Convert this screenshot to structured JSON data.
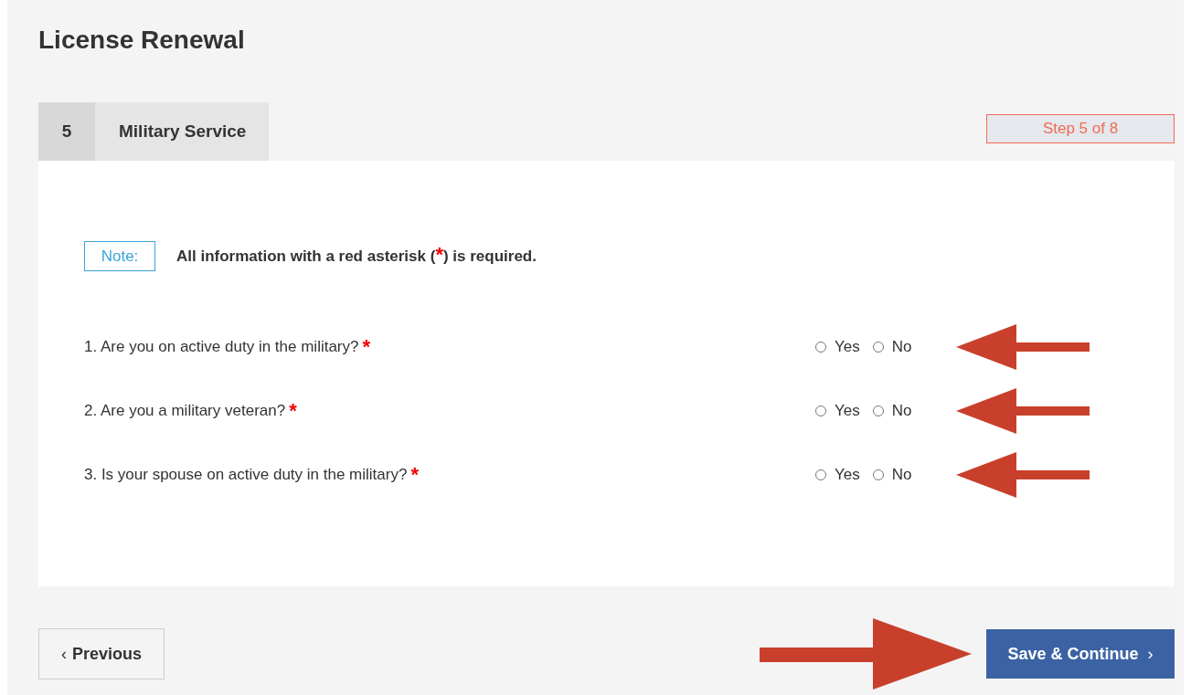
{
  "page_title": "License Renewal",
  "section": {
    "number": "5",
    "title": "Military Service"
  },
  "step_indicator": "Step 5 of 8",
  "note": {
    "label": "Note:",
    "text_before": "All information with a red asterisk (",
    "asterisk": "*",
    "text_after": ") is required."
  },
  "questions": [
    {
      "text": "1. Are you on active duty in the military?",
      "required_mark": "*",
      "options": [
        {
          "label": "Yes",
          "selected": false
        },
        {
          "label": "No",
          "selected": false
        }
      ]
    },
    {
      "text": "2. Are you a military veteran?",
      "required_mark": "*",
      "options": [
        {
          "label": "Yes",
          "selected": false
        },
        {
          "label": "No",
          "selected": false
        }
      ]
    },
    {
      "text": "3. Is your spouse on active duty in the military?",
      "required_mark": "*",
      "options": [
        {
          "label": "Yes",
          "selected": false
        },
        {
          "label": "No",
          "selected": false
        }
      ]
    }
  ],
  "buttons": [
    {
      "kind": "secondary",
      "icon": "‹",
      "label": "Previous"
    },
    {
      "kind": "primary",
      "icon": "›",
      "label": "Save & Continue"
    }
  ]
}
